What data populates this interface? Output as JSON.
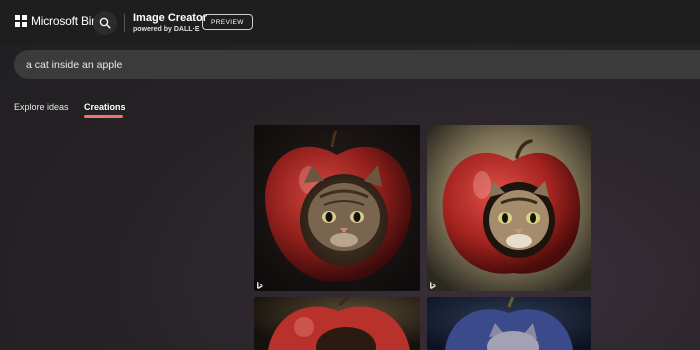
{
  "header": {
    "brand_name": "Microsoft Bing",
    "product_title": "Image Creator",
    "product_subtitle": "powered by DALL·E",
    "badge": "PREVIEW"
  },
  "search": {
    "value": "a cat inside an apple"
  },
  "tabs": [
    {
      "label": "Explore ideas",
      "active": false
    },
    {
      "label": "Creations",
      "active": true
    }
  ],
  "colors": {
    "accent_underline": "#ee7373",
    "header_bg": "#1e1e1e",
    "search_bg": "#3b3b3b"
  },
  "results": [
    {
      "description": "red apple with kitten peeking out, dark background"
    },
    {
      "description": "red apple with kitten face in hole, tan background"
    },
    {
      "description": "red apple with kitten, dark background (partially visible)"
    },
    {
      "description": "blue-toned apple with kitten (partially visible)"
    }
  ]
}
